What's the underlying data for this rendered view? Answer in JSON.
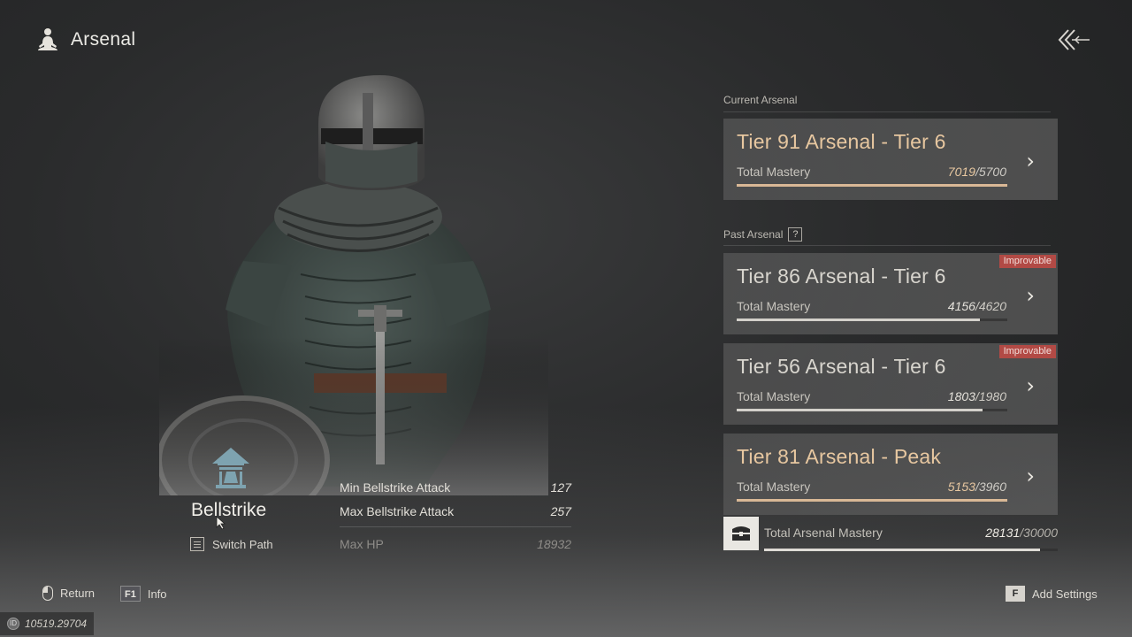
{
  "header": {
    "title": "Arsenal",
    "icon": "meditation-figure-icon",
    "back_icon": "double-chevron-back-icon"
  },
  "path": {
    "name": "Bellstrike",
    "icon": "bell-temple-icon",
    "switch_label": "Switch Path"
  },
  "stats": [
    {
      "label": "Min Bellstrike Attack",
      "value": "127"
    },
    {
      "label": "Max Bellstrike Attack",
      "value": "257"
    },
    {
      "label": "Max HP",
      "value": "18932"
    }
  ],
  "current_arsenal": {
    "label": "Current Arsenal",
    "card": {
      "title": "Tier 91 Arsenal - Tier 6",
      "mastery_label": "Total Mastery",
      "current": "7019",
      "max": "/5700",
      "progress": 1.0
    }
  },
  "past_arsenal": {
    "label": "Past Arsenal",
    "help": "?",
    "cards": [
      {
        "title": "Tier 86 Arsenal - Tier 6",
        "mastery_label": "Total Mastery",
        "current": "4156",
        "max": "/4620",
        "progress": 0.9,
        "badge": "Improvable"
      },
      {
        "title": "Tier 56 Arsenal - Tier 6",
        "mastery_label": "Total Mastery",
        "current": "1803",
        "max": "/1980",
        "progress": 0.91,
        "badge": "Improvable"
      },
      {
        "title": "Tier 81 Arsenal - Peak",
        "mastery_label": "Total Mastery",
        "current": "5153",
        "max": "/3960",
        "progress": 1.0,
        "badge": ""
      }
    ]
  },
  "total": {
    "label": "Total Arsenal Mastery",
    "current": "28131",
    "max": "/30000",
    "progress": 0.94,
    "icon": "chest-icon"
  },
  "footer": {
    "return_label": "Return",
    "info_key": "F1",
    "info_label": "Info",
    "settings_key": "F",
    "settings_label": "Add Settings"
  },
  "uid": {
    "text": "10519.29704"
  },
  "colors": {
    "gold": "#e7c7a0",
    "badge": "#b24a45",
    "card_bg": "#5c5c5c"
  }
}
